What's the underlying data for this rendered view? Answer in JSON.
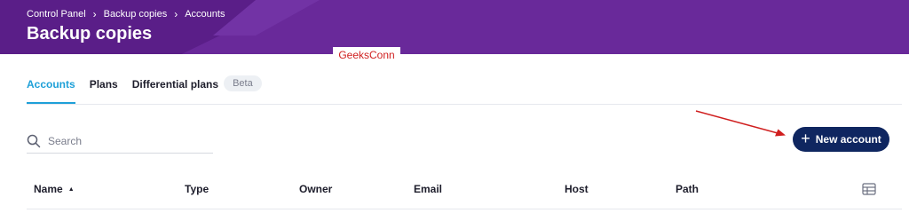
{
  "header": {
    "breadcrumb": [
      "Control Panel",
      "Backup copies",
      "Accounts"
    ],
    "title": "Backup copies"
  },
  "watermark": "GeeksConn",
  "tabs": [
    {
      "label": "Accounts",
      "active": true
    },
    {
      "label": "Plans",
      "active": false
    },
    {
      "label": "Differential plans",
      "active": false
    }
  ],
  "tab_badge": "Beta",
  "search": {
    "placeholder": "Search",
    "value": ""
  },
  "new_account_button": {
    "label": "New account",
    "icon": "plus-icon"
  },
  "table": {
    "columns": [
      {
        "label": "Name",
        "sorted": "ascending"
      },
      {
        "label": "Type"
      },
      {
        "label": "Owner"
      },
      {
        "label": "Email"
      },
      {
        "label": "Host"
      },
      {
        "label": "Path"
      }
    ],
    "column_settings_icon": "table-columns-icon"
  },
  "colors": {
    "header_bg": "#69299a",
    "active_tab": "#1ea0d8",
    "primary_button": "#0f2660",
    "annotation_arrow": "#d01f1f"
  }
}
